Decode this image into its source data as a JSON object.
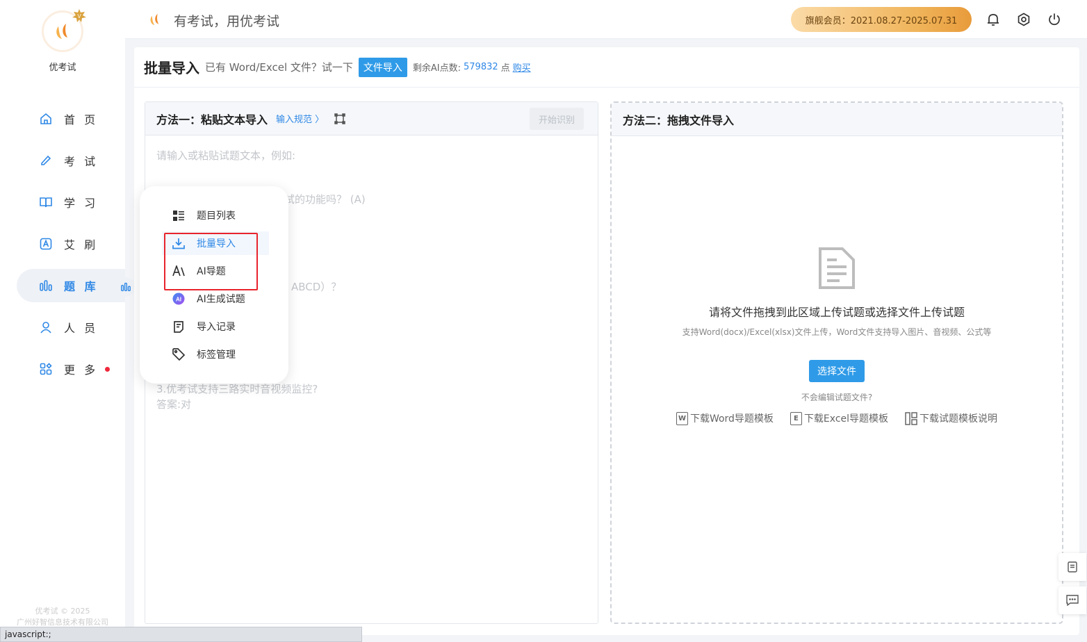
{
  "sidebar": {
    "logo_text": "优考试",
    "items": [
      {
        "label": "首 页",
        "icon": "home-icon"
      },
      {
        "label": "考 试",
        "icon": "pencil-icon"
      },
      {
        "label": "学 习",
        "icon": "book-icon"
      },
      {
        "label": "艾 刷",
        "icon": "a-square-icon"
      },
      {
        "label": "题 库",
        "icon": "bar-chart-icon"
      },
      {
        "label": "人 员",
        "icon": "user-icon"
      },
      {
        "label": "更 多",
        "icon": "apps-icon"
      }
    ],
    "footer_line1": "优考试 © 2025",
    "footer_line2": "广州好智信息技术有限公司"
  },
  "topbar": {
    "slogan": "有考试，用优考试",
    "vip_label": "旗舰会员：2021.08.27-2025.07.31"
  },
  "main": {
    "title": "批量导入",
    "hint": "已有 Word/Excel 文件？试一下",
    "file_import_btn": "文件导入",
    "ai_points_label": "剩余AI点数:",
    "ai_points_value": "579832",
    "ai_points_unit": "点",
    "buy_link": "购买"
  },
  "method1": {
    "title": "方法一：粘贴文本导入",
    "spec_link": "输入规范 〉",
    "start_btn": "开始识别",
    "placeholder_lines": [
      "请输入或粘贴试题文本，例如:",
      "试的功能吗？ (A)",
      "ABCD）？",
      "3.优考试支持三路实时音视频监控?",
      "答案:对"
    ]
  },
  "method2": {
    "title": "方法二：拖拽文件导入",
    "drop_title": "请将文件拖拽到此区域上传试题或选择文件上传试题",
    "drop_sub": "支持Word(docx)/Excel(xlsx)文件上传，Word文件支持导入图片、音视频、公式等",
    "choose_btn": "选择文件",
    "no_edit": "不会编辑试题文件?",
    "downloads": [
      {
        "icon_letter": "W",
        "label": "下载Word导题模板"
      },
      {
        "icon_letter": "E",
        "label": "下载Excel导题模板"
      },
      {
        "icon_letter": "",
        "label": "下载试题模板说明"
      }
    ]
  },
  "dropdown": {
    "items": [
      {
        "label": "题目列表",
        "icon": "list-icon"
      },
      {
        "label": "批量导入",
        "icon": "download-icon"
      },
      {
        "label": "AI导题",
        "icon": "ai-text-icon"
      },
      {
        "label": "AI生成试题",
        "icon": "ai-badge-icon"
      },
      {
        "label": "导入记录",
        "icon": "record-icon"
      },
      {
        "label": "标签管理",
        "icon": "tag-icon"
      }
    ]
  },
  "statusbar": {
    "text": "javascript:;"
  },
  "colors": {
    "accent": "#2f88e6",
    "button": "#2f9be8",
    "highlight_box": "#e8232c",
    "vip_gold": "#f0b45a"
  }
}
